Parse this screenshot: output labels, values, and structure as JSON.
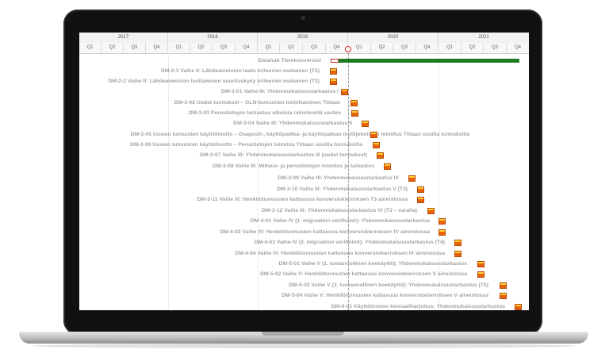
{
  "years": [
    "2017",
    "2018",
    "2019",
    "2020",
    "2021"
  ],
  "quarters": [
    "Q1",
    "Q2",
    "Q3",
    "Q4",
    "Q1",
    "Q2",
    "Q3",
    "Q4",
    "Q1",
    "Q2",
    "Q3",
    "Q4",
    "Q1",
    "Q2",
    "Q3",
    "Q4",
    "Q1",
    "Q2",
    "Q3",
    "Q4"
  ],
  "rows": [
    "Datahub Tietokonversiot",
    "DM-2-1 Vaihe II: Lähdeaineiston laatu kriteerien mukainen (T2)",
    "DM-2-2 Vaihe II: Lähdeaineiston tuottamisen suorituskyky kriteerien mukainen (T2)",
    "DM-3-01 Vaihe III: Yhdenmukaisuustarkastus I",
    "DM-3-02 Uudet tunnukset – GLN-tunnusten toimittaminen Tittaan",
    "DM-3-03 Perustietojen tarkastus ulkoisia rekistereitä vasten",
    "DM-3-04 Vaihe III: Yhdenmukaisuustarkastus II",
    "DM-3-05 Uusien tunnusten käyttöönotto – Osapuoli-, käyttöpaikka- ja käyttöpaikan mySijetietojen toimitus Tittaan uusilla tunnuksilla",
    "DM-3-06 Uusien tunnusten käyttöönotto – Perustietojen toimitus Tittaan uusilla tunnuksilla",
    "DM-3-07 Vaihe III: Yhdenmukaisuustarkastus III (uudet tunnukset)",
    "DM-3-08 Vaihe III: Mittaus- ja perustietojen toimitus ja tarkastus",
    "DM-3-09 Vaihe III: Yhdenmukaisuustarkastus IV",
    "DM-3-10 Vaihe III: Yhdenmukaisuustarkastus V (T3)",
    "DM-3-11 Vaihe III: Henkilötunnusten kattavuus konversiokierroksen T3 aineistossa",
    "DM-3-12 Vaihe III: Yhdenmukaisuustarkastus VI (T3 – varalla)",
    "DM-4-01 Vaihe IV (1. migraation verifiointi): Yhdenmukaisuustarkastus",
    "DM-4-02 Vaihe IV: Henkilötunnusten kattavuus konversiokierroksen IV aineistossa",
    "DM-4-03 Vaihe IV (2. migraation verifiointi): Yhdenmukaisuustarkastus (T4)",
    "DM-4-04 Vaihe IV: Henkilötunnusten kattavuus konversiokierroksen IV aineistossa",
    "DM-5-01 Vaihe V (1. tuotannollinen koekäyttö): Yhdenmukaisuustarkastus",
    "DM-5-02 Vaihe V: Henkilötunnusten kattavuus konversiokierroksen V aineistossa",
    "DM-5-03 Vaihe V (2. tuotannollinen koekäyttö): Yhdenmukaisuustarkastus (T5)",
    "DM-5-04 Vaihe V: Henkilötunnusten kattavuus konversiokierroksen V aineistossa",
    "DM-6-01 Käyttöönoton kenraaliharjoitus: Yhdenmukaisuustarkastus"
  ],
  "colors": {
    "milestone": "#e8620c",
    "bar": "#1f7a1f",
    "today": "#e02020"
  }
}
